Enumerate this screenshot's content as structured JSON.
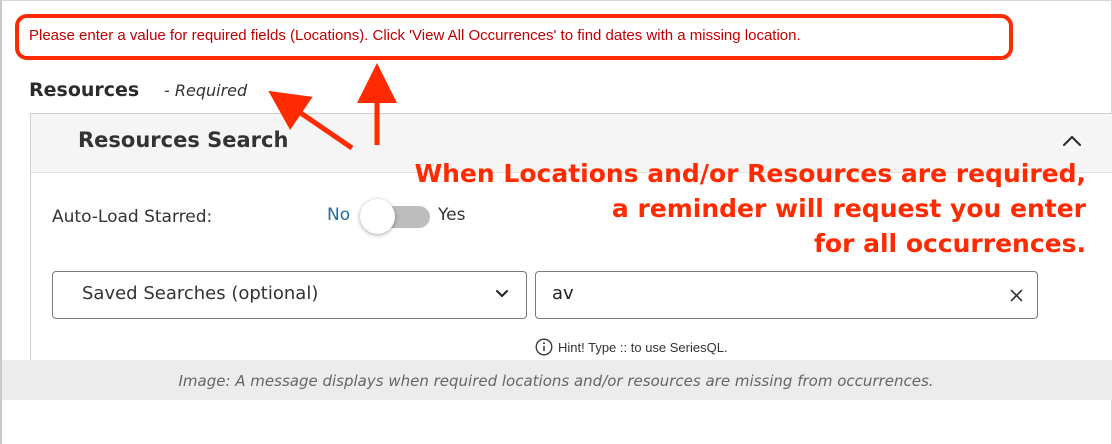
{
  "error_banner": {
    "message": "Please enter a value for required fields (Locations). Click 'View All Occurrences' to find dates with a missing location."
  },
  "resources": {
    "heading": "Resources",
    "required_text": "- Required"
  },
  "panel": {
    "title": "Resources Search",
    "collapse_icon": "chevron-up-icon"
  },
  "auto_load": {
    "label": "Auto-Load Starred:",
    "off_label": "No",
    "on_label": "Yes",
    "state": "No"
  },
  "saved_searches": {
    "selected": "Saved Searches (optional)",
    "icon": "chevron-down-icon"
  },
  "search": {
    "value": "av",
    "clear_icon": "close-icon"
  },
  "hint": {
    "icon": "info-icon",
    "text": "Hint! Type :: to use SeriesQL."
  },
  "annotation": {
    "lines": [
      "When Locations and/or Resources are required,",
      "a reminder will request you enter",
      "for all occurrences."
    ],
    "color": "#ff2a00"
  },
  "caption": {
    "text": "Image: A message displays when required locations and/or resources are missing from occurrences."
  }
}
